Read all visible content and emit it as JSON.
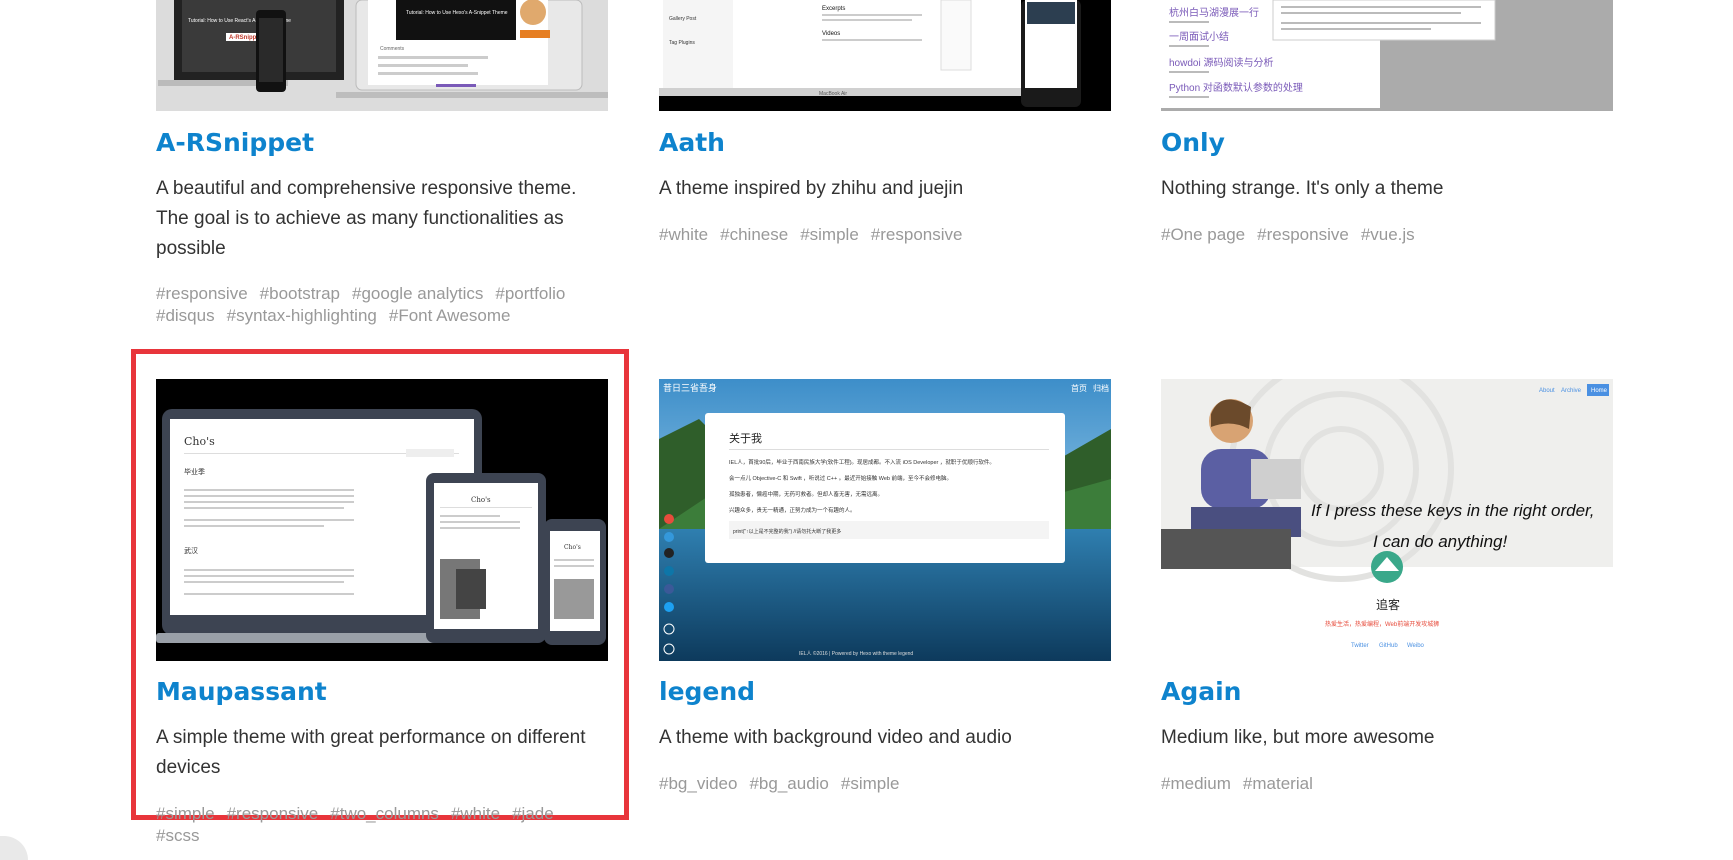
{
  "cards": [
    {
      "title": "A-RSnippet",
      "description": "A beautiful and comprehensive responsive theme. The goal is to achieve as many functionalities as possible",
      "tags": [
        "#responsive",
        "#bootstrap",
        "#google analytics",
        "#portfolio",
        "#disqus",
        "#syntax-highlighting",
        "#Font Awesome"
      ],
      "thumb": {
        "text_1": "Tutorial: How to Use React's A-Snippet Theme",
        "text_2": "A-RSnippet",
        "text_3": "Tutorial: How to Use Hexo's A-Snippet Theme",
        "text_4": "Comments"
      }
    },
    {
      "title": "Aath",
      "description": "A theme inspired by zhihu and juejin",
      "tags": [
        "#white",
        "#chinese",
        "#simple",
        "#responsive"
      ],
      "thumb": {
        "text_1": "Excerpts",
        "text_2": "Gallery Post",
        "text_3": "Videos",
        "text_4": "Tag Plugins",
        "text_5": "MacBook Air"
      }
    },
    {
      "title": "Only",
      "description": "Nothing strange. It's only a theme",
      "tags": [
        "#One page",
        "#responsive",
        "#vue.js"
      ],
      "thumb": {
        "link_1": "杭州白马湖漫展一行",
        "link_2": "一周面试小结",
        "link_3": "howdoi 源码阅读与分析",
        "link_4": "Python 对函数默认参数的处理"
      }
    },
    {
      "title": "Maupassant",
      "description": "A simple theme with great performance on different devices",
      "tags": [
        "#simple",
        "#responsive",
        "#two_columns",
        "#white",
        "#jade",
        "#scss"
      ],
      "thumb": {
        "site_name": "Cho's",
        "post_1": "毕业季",
        "post_2": "武汉"
      }
    },
    {
      "title": "legend",
      "description": "A theme with background video and audio",
      "tags": [
        "#bg_video",
        "#bg_audio",
        "#simple"
      ],
      "thumb": {
        "site_name": "昔日三省吾身",
        "nav_home": "首页",
        "nav_archive": "归档",
        "panel_title": "关于我",
        "line_1": "IEL人，首批90后，毕业于西南民族大学(软件工程)。现居成都。不入流 iOS Developer ，就职于优顺行软件。",
        "line_2": "会一点儿 Objective-C 和 Swift ，听说过 C++ 。最近开始接触 Web 前端，至今不会修电脑。",
        "line_3": "孤独患者，懒癌中期，无药可救者。但却人畜无害，无需远离。",
        "line_4": "兴趣众多，贵无一精通，正努力成为一个有趣的人。",
        "code": "print(\"↑以上是不完整的我\") //请勿托大断了我更多",
        "footer": "IEL人 ©2016 | Powered by Hexo with theme legend"
      }
    },
    {
      "title": "Again",
      "description": "Medium like, but more awesome",
      "tags": [
        "#medium",
        "#material"
      ],
      "thumb": {
        "nav_about": "About",
        "nav_archive": "Archive",
        "nav_home": "Home",
        "comic_line_1": "If I press these keys in the right order,",
        "comic_line_2": "I can do anything!",
        "site_name": "追客",
        "tagline": "热爱生活，热爱编程，Web前端开发攻城狮",
        "link_twitter": "Twitter",
        "link_github": "GitHub",
        "link_weibo": "Weibo"
      }
    }
  ]
}
